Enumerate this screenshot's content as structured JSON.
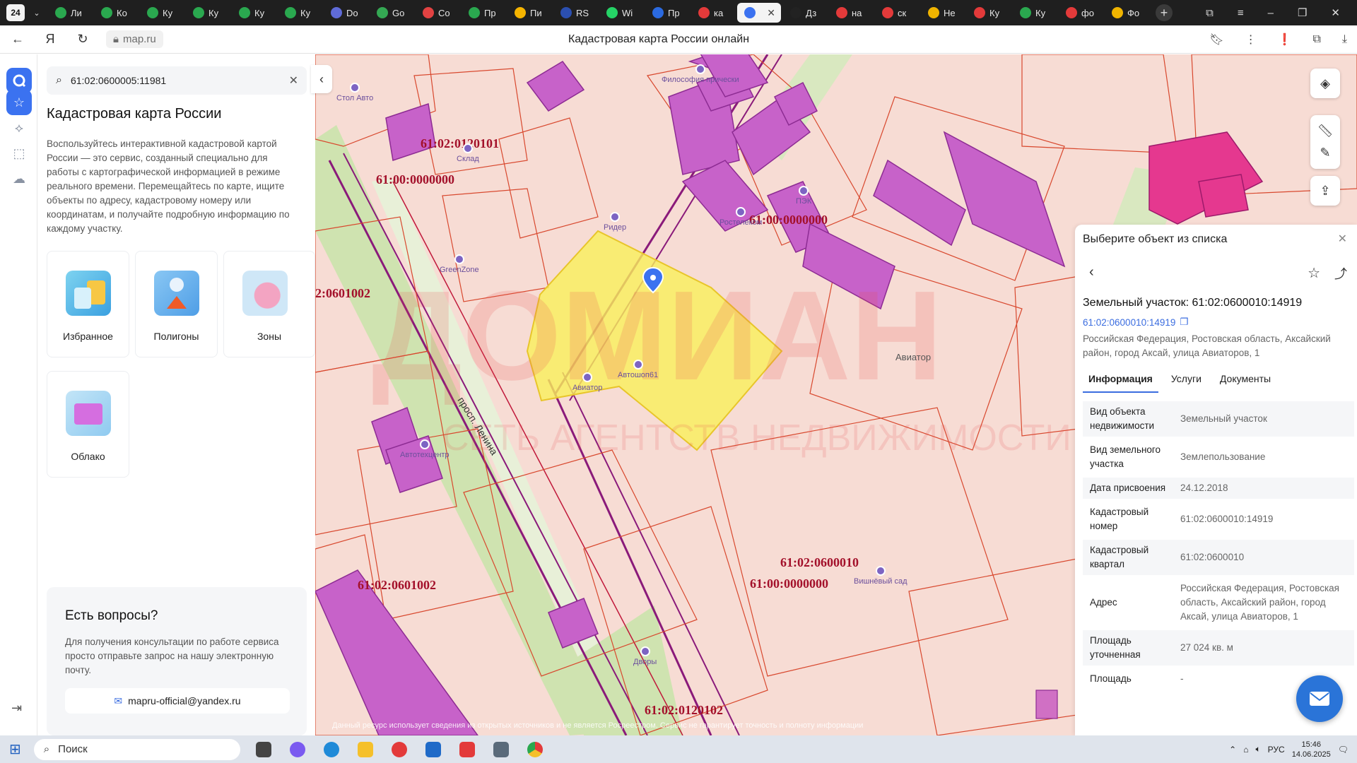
{
  "browser": {
    "tab_counter": "24",
    "tabs": [
      {
        "label": "Ли",
        "color": "#2aa84f"
      },
      {
        "label": "Ко",
        "color": "#2aa84f"
      },
      {
        "label": "Ку",
        "color": "#2aa84f"
      },
      {
        "label": "Ку",
        "color": "#2aa84f"
      },
      {
        "label": "Ку",
        "color": "#2aa84f"
      },
      {
        "label": "Ку",
        "color": "#2aa84f"
      },
      {
        "label": "Do",
        "color": "#5f6bd8"
      },
      {
        "label": "Go",
        "color": "#34a853"
      },
      {
        "label": "Co",
        "color": "#e24242"
      },
      {
        "label": "Пр",
        "color": "#2aa84f"
      },
      {
        "label": "Пи",
        "color": "#f5b400"
      },
      {
        "label": "RS",
        "color": "#2b4fb0"
      },
      {
        "label": "Wi",
        "color": "#25d366"
      },
      {
        "label": "Пр",
        "color": "#2b6ae0"
      },
      {
        "label": "ка",
        "color": "#e33a3a"
      },
      {
        "label": "",
        "color": "#3b72f0",
        "active": true
      },
      {
        "label": "Дз",
        "color": "#222222"
      },
      {
        "label": "на",
        "color": "#e33a3a"
      },
      {
        "label": "ск",
        "color": "#e33a3a"
      },
      {
        "label": "Не",
        "color": "#f0b400"
      },
      {
        "label": "Ку",
        "color": "#e33a3a"
      },
      {
        "label": "Ку",
        "color": "#2aa84f"
      },
      {
        "label": "фо",
        "color": "#e33a3a"
      },
      {
        "label": "Фо",
        "color": "#f0b400"
      }
    ],
    "url": "map.ru",
    "page_title": "Кадастровая карта России онлайн"
  },
  "sidebar": {
    "search_value": "61:02:0600005:11981",
    "title": "Кадастровая карта России",
    "description": "Воспользуйтесь интерактивной кадастровой картой России — это сервис, созданный специально для работы с картографической информацией в режиме реального времени. Перемещайтесь по карте, ищите объекты по адресу, кадастровому номеру или координатам, и получайте подробную информацию по каждому участку.",
    "cards": [
      {
        "label": "Избранное"
      },
      {
        "label": "Полигоны"
      },
      {
        "label": "Зоны"
      },
      {
        "label": "Облако"
      }
    ],
    "help": {
      "title": "Есть вопросы?",
      "text": "Для получения консультации по работе сервиса просто отправьте запрос на нашу электронную почту.",
      "email": "mapru-official@yandex.ru"
    }
  },
  "map": {
    "labels": [
      "61:02:0120101",
      "61:00:0000000",
      "2:0601002",
      "61:00:0000000",
      "61:02:0601002",
      "61:02:0600010",
      "61:00:0000000",
      "61:02:0120102"
    ],
    "road": "просп. Ленина",
    "pois": [
      "Стол Авто",
      "Склад",
      "GreenZone",
      "Ридер",
      "Ростелеком",
      "ПЭК",
      "Автошоп61",
      "Авиатор",
      "Автотехцентр",
      "Вишнёвый сад",
      "Дворы",
      "Философия прически"
    ],
    "area_label": "Авиатор",
    "watermark": "Данный ресурс использует сведения из открытых источников и не является Росреестром. Сервис не гарантирует точность и полноту информации"
  },
  "info": {
    "header": "Выберите объект из списка",
    "title": "Земельный участок: 61:02:0600010:14919",
    "cad_link": "61:02:0600010:14919",
    "address": "Российская Федерация, Ростовская область, Аксайский район, город Аксай, улица Авиаторов, 1",
    "tabs": [
      "Информация",
      "Услуги",
      "Документы"
    ],
    "rows": [
      {
        "k": "Вид объекта недвижимости",
        "v": "Земельный участок"
      },
      {
        "k": "Вид земельного участка",
        "v": "Землепользование"
      },
      {
        "k": "Дата присвоения",
        "v": "24.12.2018"
      },
      {
        "k": "Кадастровый номер",
        "v": "61:02:0600010:14919"
      },
      {
        "k": "Кадастровый квартал",
        "v": "61:02:0600010"
      },
      {
        "k": "Адрес",
        "v": "Российская Федерация, Ростовская область, Аксайский район, город Аксай, улица Авиаторов, 1"
      },
      {
        "k": "Площадь уточненная",
        "v": "27 024 кв. м"
      },
      {
        "k": "Площадь",
        "v": "-"
      }
    ]
  },
  "taskbar": {
    "search_placeholder": "Поиск",
    "lang": "РУС",
    "time": "15:46",
    "date": "14.06.2025"
  }
}
